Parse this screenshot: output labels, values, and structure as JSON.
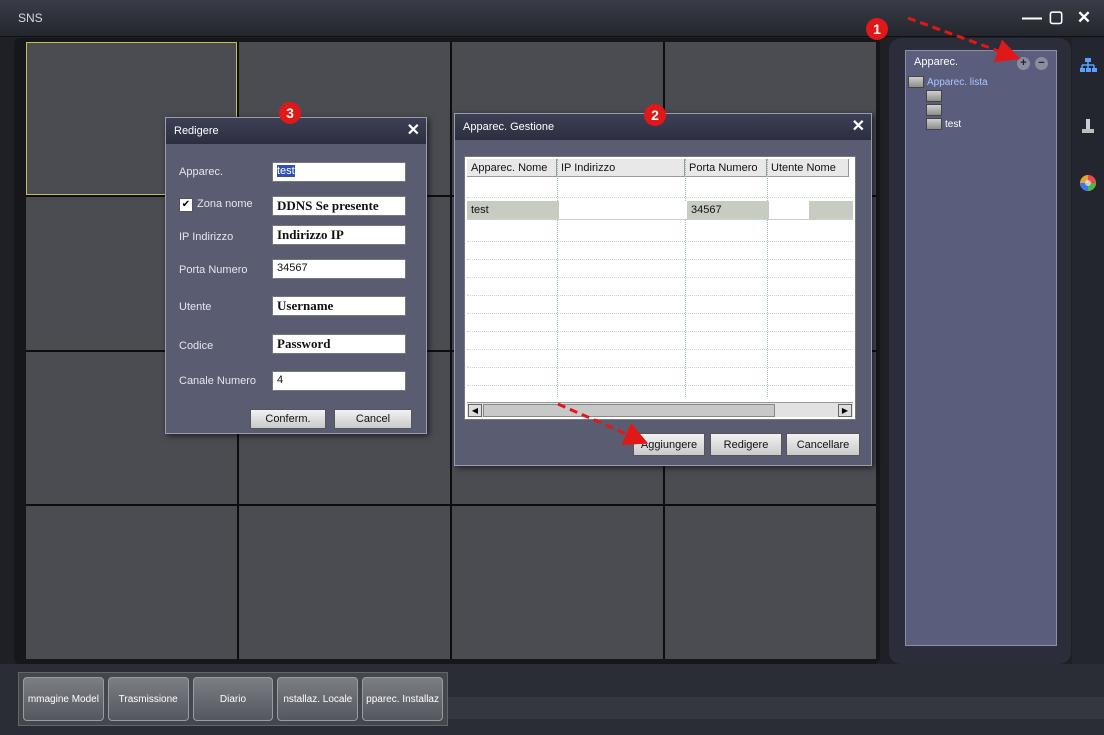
{
  "app": {
    "title": "SNS"
  },
  "window_controls": {
    "minimize": "—",
    "maximize": "▢",
    "close": "✕"
  },
  "device_panel": {
    "title": "Apparec.",
    "add": "+",
    "remove": "−",
    "tree": {
      "root": "Apparec. lista",
      "items": [
        "",
        "",
        "test"
      ]
    }
  },
  "bottom_tabs": [
    "mmagine Model",
    "Trasmissione",
    "Diario",
    "nstallaz. Locale",
    "pparec. Installaz"
  ],
  "edit_dialog": {
    "title": "Redigere",
    "close": "✕",
    "fields": {
      "device_label": "Apparec.",
      "device_value": "test",
      "zone_label": "Zona nome",
      "zone_checked": "✔",
      "zone_value": "DDNS Se presente",
      "ip_label": "IP Indirizzo",
      "ip_value": "Indirizzo IP",
      "port_label": "Porta Numero",
      "port_value": "34567",
      "user_label": "Utente",
      "user_value": "Username",
      "code_label": "Codice",
      "code_value": "Password",
      "channel_label": "Canale Numero",
      "channel_value": "4"
    },
    "confirm": "Conferm.",
    "cancel": "Cancel"
  },
  "manage_dialog": {
    "title": "Apparec. Gestione",
    "close": "✕",
    "columns": [
      "Apparec. Nome",
      "IP Indirizzo",
      "Porta Numero",
      "Utente Nome"
    ],
    "rows": [
      [
        "test",
        "",
        "34567",
        ""
      ]
    ],
    "add": "Aggiungere",
    "edit": "Redigere",
    "delete": "Cancellare"
  },
  "markers": [
    "1",
    "2",
    "3"
  ],
  "colors": {
    "marker": "#e01818",
    "panel": "#5a5d7c",
    "accent_selection": "#2e4fb5"
  }
}
